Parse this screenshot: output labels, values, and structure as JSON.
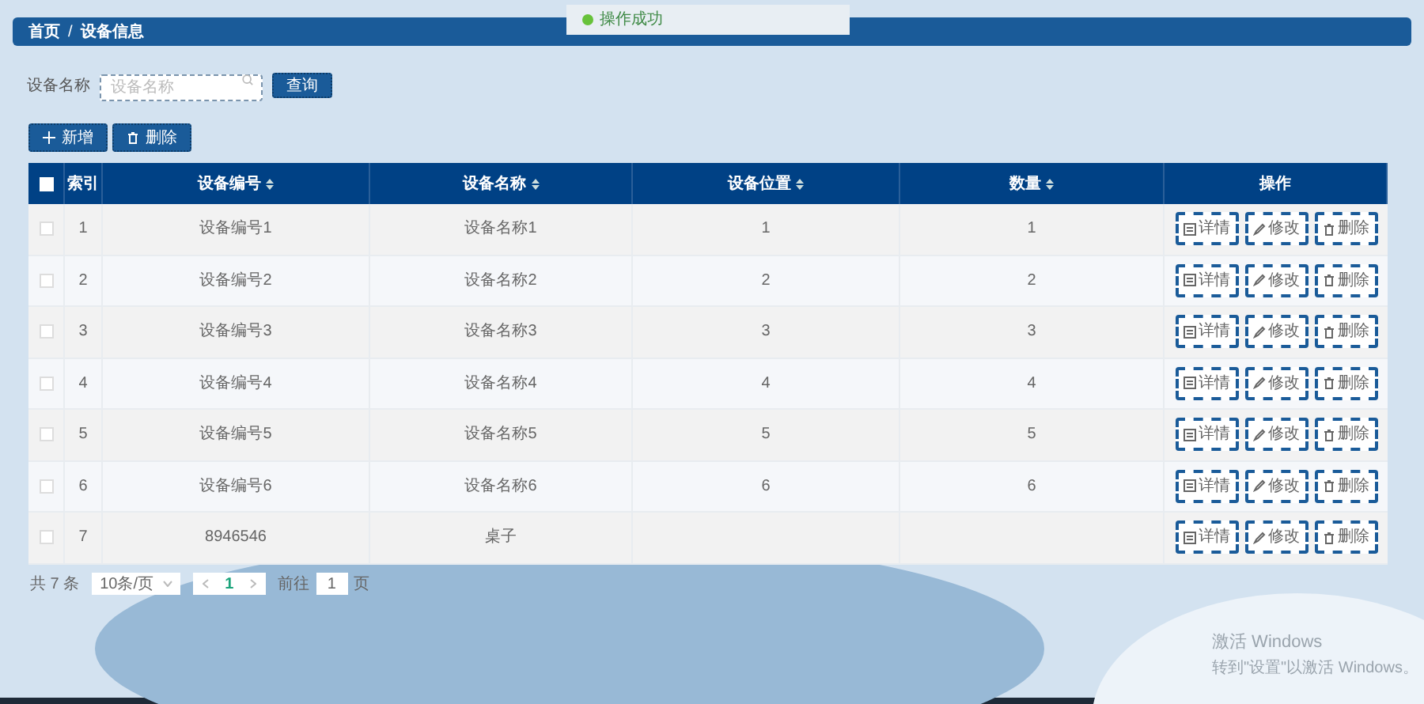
{
  "toast": {
    "text": "操作成功"
  },
  "breadcrumb": {
    "items": [
      "首页",
      "设备信息"
    ],
    "separator": "/"
  },
  "search": {
    "label": "设备名称",
    "placeholder": "设备名称",
    "button": "查询"
  },
  "toolbar": [
    {
      "kind": "add",
      "label": "新增"
    },
    {
      "kind": "delete",
      "label": "删除"
    }
  ],
  "table": {
    "header_checked": false,
    "columns": [
      {
        "label": "索引",
        "sortable": false
      },
      {
        "label": "设备编号",
        "sortable": true
      },
      {
        "label": "设备名称",
        "sortable": true
      },
      {
        "label": "设备位置",
        "sortable": true
      },
      {
        "label": "数量",
        "sortable": true
      },
      {
        "label": "操作",
        "sortable": false
      }
    ],
    "rows": [
      {
        "checked": false,
        "cells": [
          "1",
          "设备编号1",
          "设备名称1",
          "1",
          "1"
        ],
        "actions": [
          {
            "kind": "detail",
            "label": "详情"
          },
          {
            "kind": "edit",
            "label": "修改"
          },
          {
            "kind": "delete",
            "label": "删除"
          }
        ]
      },
      {
        "checked": false,
        "cells": [
          "2",
          "设备编号2",
          "设备名称2",
          "2",
          "2"
        ],
        "actions": [
          {
            "kind": "detail",
            "label": "详情"
          },
          {
            "kind": "edit",
            "label": "修改"
          },
          {
            "kind": "delete",
            "label": "删除"
          }
        ]
      },
      {
        "checked": false,
        "cells": [
          "3",
          "设备编号3",
          "设备名称3",
          "3",
          "3"
        ],
        "actions": [
          {
            "kind": "detail",
            "label": "详情"
          },
          {
            "kind": "edit",
            "label": "修改"
          },
          {
            "kind": "delete",
            "label": "删除"
          }
        ]
      },
      {
        "checked": false,
        "cells": [
          "4",
          "设备编号4",
          "设备名称4",
          "4",
          "4"
        ],
        "actions": [
          {
            "kind": "detail",
            "label": "详情"
          },
          {
            "kind": "edit",
            "label": "修改"
          },
          {
            "kind": "delete",
            "label": "删除"
          }
        ]
      },
      {
        "checked": false,
        "cells": [
          "5",
          "设备编号5",
          "设备名称5",
          "5",
          "5"
        ],
        "actions": [
          {
            "kind": "detail",
            "label": "详情"
          },
          {
            "kind": "edit",
            "label": "修改"
          },
          {
            "kind": "delete",
            "label": "删除"
          }
        ]
      },
      {
        "checked": false,
        "cells": [
          "6",
          "设备编号6",
          "设备名称6",
          "6",
          "6"
        ],
        "actions": [
          {
            "kind": "detail",
            "label": "详情"
          },
          {
            "kind": "edit",
            "label": "修改"
          },
          {
            "kind": "delete",
            "label": "删除"
          }
        ]
      },
      {
        "checked": false,
        "cells": [
          "7",
          "8946546",
          "桌子",
          "",
          ""
        ],
        "actions": [
          {
            "kind": "detail",
            "label": "详情"
          },
          {
            "kind": "edit",
            "label": "修改"
          },
          {
            "kind": "delete",
            "label": "删除"
          }
        ]
      }
    ]
  },
  "pagination": {
    "total": "共 7 条",
    "page_size": "10条/页",
    "pages": [
      {
        "label": "1",
        "selected": true
      }
    ],
    "goto_label": "前往",
    "goto_value": "1",
    "goto_suffix": "页"
  },
  "os_notice": {
    "title": "激活 Windows",
    "text": "转到\"设置\"以激活 Windows。"
  }
}
